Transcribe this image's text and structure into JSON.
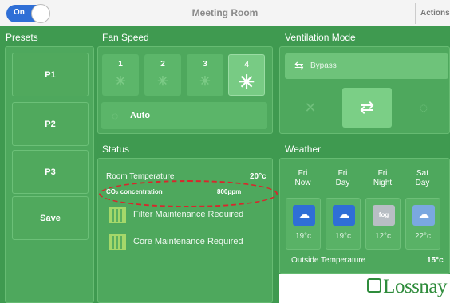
{
  "topbar": {
    "toggle_label": "On",
    "title": "Meeting Room",
    "actions": "Actions"
  },
  "headers": {
    "presets": "Presets",
    "fan_speed": "Fan Speed",
    "ventilation": "Ventilation Mode",
    "status": "Status",
    "weather": "Weather"
  },
  "presets": [
    "P1",
    "P2",
    "P3",
    "Save"
  ],
  "fan_speed": {
    "levels": [
      "1",
      "2",
      "3",
      "4"
    ],
    "selected": "4",
    "auto_label": "Auto"
  },
  "ventilation": {
    "selected_label": "Bypass",
    "modes": [
      "energy-recovery",
      "bypass",
      "auto"
    ],
    "selected_mode": "bypass"
  },
  "status": {
    "room_temp_label": "Room Temperature",
    "room_temp_value": "20°c",
    "co2_label": "CO₂ concentration",
    "co2_value": "800ppm",
    "filter_label": "Filter Maintenance Required",
    "core_label": "Core Maintenance Required"
  },
  "weather": {
    "forecast": [
      {
        "day": "Fri",
        "period": "Now",
        "icon": "sun-cloud-rain-icon",
        "temp": "19°c"
      },
      {
        "day": "Fri",
        "period": "Day",
        "icon": "sun-cloud-rain-icon",
        "temp": "19°c"
      },
      {
        "day": "Fri",
        "period": "Night",
        "icon": "fog-icon",
        "icon_text": "fog",
        "temp": "12°c"
      },
      {
        "day": "Sat",
        "period": "Day",
        "icon": "cloud-icon",
        "temp": "22°c"
      }
    ],
    "outside_label": "Outside Temperature",
    "outside_value": "15°c"
  },
  "brand": "Lossnay",
  "colors": {
    "background": "#3f9a50",
    "accent_blue": "#2f6fd6",
    "annotation_red": "#d9262c"
  }
}
